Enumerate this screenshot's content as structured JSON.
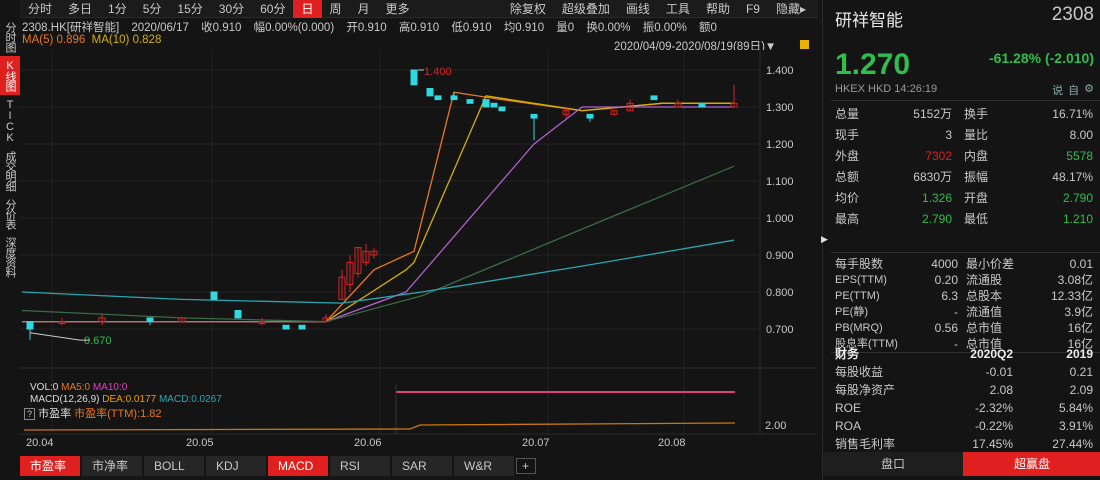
{
  "topbar": {
    "tabs": [
      "分时",
      "多日",
      "1分",
      "5分",
      "15分",
      "30分",
      "60分",
      "日",
      "周",
      "月",
      "更多"
    ],
    "active": 7,
    "right": [
      "除复权",
      "超级叠加",
      "画线",
      "工具",
      "帮助",
      "F9",
      "隐藏▸"
    ]
  },
  "sidetabs": [
    "分时图",
    "K线图",
    "TICK",
    "成交明细",
    "分价表",
    "深度资料"
  ],
  "info": {
    "symbol": "2308.HK[研祥智能]",
    "date": "2020/06/17",
    "close": "收0.910",
    "change": "幅0.00%(0.000)",
    "open": "开0.910",
    "high": "高0.910",
    "low": "低0.910",
    "avg": "均0.910",
    "vol": "量0",
    "turnover": "换0.00%",
    "amp": "振0.00%",
    "amount": "额0"
  },
  "ma": {
    "ma5": "MA(5) 0.896",
    "ma10": "MA(10) 0.828"
  },
  "date_range": "2020/04/09-2020/08/19(89日)▼",
  "indicators": {
    "row1": [
      "VOL:0",
      "MA5:0",
      "MA10:0"
    ],
    "row2": [
      "MACD(12,26,9)",
      "DEA:0.0177",
      "MACD:0.0267"
    ],
    "row3": [
      "市盈率",
      "市盈率(TTM):1.82"
    ],
    "axis": "2.00"
  },
  "chart_data": {
    "type": "candlestick",
    "ylim": [
      0.65,
      1.45
    ],
    "yticks": [
      "1.400",
      "1.300",
      "1.200",
      "1.100",
      "1.000",
      "0.900",
      "0.800",
      "0.700"
    ],
    "xticks": [
      {
        "label": "20.04",
        "i": 0
      },
      {
        "label": "20.05",
        "i": 20
      },
      {
        "label": "20.06",
        "i": 41
      },
      {
        "label": "20.07",
        "i": 62
      },
      {
        "label": "20.08",
        "i": 79
      }
    ],
    "max_label": "1.400",
    "min_label": "0.670",
    "candles": [
      [
        1,
        0.72,
        0.7,
        0.72,
        0.67
      ],
      [
        5,
        0.72,
        0.72,
        0.73,
        0.71
      ],
      [
        10,
        0.72,
        0.73,
        0.74,
        0.71
      ],
      [
        16,
        0.73,
        0.72,
        0.73,
        0.71
      ],
      [
        20,
        0.72,
        0.73,
        0.73,
        0.72
      ],
      [
        24,
        0.8,
        0.78,
        0.8,
        0.78
      ],
      [
        27,
        0.75,
        0.73,
        0.75,
        0.73
      ],
      [
        30,
        0.72,
        0.72,
        0.73,
        0.71
      ],
      [
        33,
        0.71,
        0.7,
        0.71,
        0.7
      ],
      [
        35,
        0.71,
        0.7,
        0.71,
        0.7
      ],
      [
        38,
        0.72,
        0.73,
        0.74,
        0.72
      ],
      [
        40,
        0.78,
        0.84,
        0.86,
        0.78
      ],
      [
        41,
        0.82,
        0.88,
        0.9,
        0.8
      ],
      [
        42,
        0.85,
        0.92,
        0.92,
        0.84
      ],
      [
        43,
        0.88,
        0.91,
        0.93,
        0.87
      ],
      [
        44,
        0.9,
        0.91,
        0.92,
        0.89
      ],
      [
        49,
        1.4,
        1.36,
        1.4,
        1.36
      ],
      [
        51,
        1.35,
        1.33,
        1.35,
        1.33
      ],
      [
        52,
        1.33,
        1.32,
        1.33,
        1.32
      ],
      [
        54,
        1.33,
        1.32,
        1.34,
        1.32
      ],
      [
        56,
        1.32,
        1.31,
        1.32,
        1.31
      ],
      [
        58,
        1.32,
        1.3,
        1.32,
        1.3
      ],
      [
        59,
        1.31,
        1.3,
        1.31,
        1.3
      ],
      [
        60,
        1.3,
        1.29,
        1.3,
        1.29
      ],
      [
        64,
        1.28,
        1.27,
        1.28,
        1.21
      ],
      [
        68,
        1.28,
        1.29,
        1.3,
        1.27
      ],
      [
        71,
        1.28,
        1.27,
        1.28,
        1.26
      ],
      [
        74,
        1.28,
        1.29,
        1.29,
        1.28
      ],
      [
        76,
        1.29,
        1.31,
        1.32,
        1.29
      ],
      [
        79,
        1.33,
        1.32,
        1.33,
        1.32
      ],
      [
        82,
        1.3,
        1.31,
        1.32,
        1.3
      ],
      [
        85,
        1.31,
        1.3,
        1.31,
        1.3
      ],
      [
        89,
        1.3,
        1.31,
        1.36,
        1.3
      ]
    ],
    "series": [
      {
        "name": "MA5",
        "color": "#e8781e",
        "points": [
          [
            0,
            0.72
          ],
          [
            38,
            0.72
          ],
          [
            44,
            0.86
          ],
          [
            48,
            0.9
          ],
          [
            49,
            0.91
          ],
          [
            54,
            1.34
          ],
          [
            60,
            1.32
          ],
          [
            70,
            1.29
          ],
          [
            80,
            1.31
          ],
          [
            89,
            1.31
          ]
        ]
      },
      {
        "name": "MA10",
        "color": "#d4b000",
        "points": [
          [
            0,
            0.72
          ],
          [
            38,
            0.72
          ],
          [
            48,
            0.86
          ],
          [
            49,
            0.88
          ],
          [
            58,
            1.33
          ],
          [
            70,
            1.29
          ],
          [
            80,
            1.31
          ],
          [
            89,
            1.31
          ]
        ]
      },
      {
        "name": "MA20",
        "color": "#b060d0",
        "points": [
          [
            0,
            0.72
          ],
          [
            38,
            0.72
          ],
          [
            48,
            0.8
          ],
          [
            64,
            1.2
          ],
          [
            70,
            1.3
          ],
          [
            76,
            1.3
          ],
          [
            89,
            1.3
          ]
        ]
      },
      {
        "name": "MA60",
        "color": "#3a6a48",
        "points": [
          [
            0,
            0.75
          ],
          [
            20,
            0.73
          ],
          [
            38,
            0.72
          ],
          [
            50,
            0.79
          ],
          [
            70,
            0.97
          ],
          [
            89,
            1.14
          ]
        ]
      },
      {
        "name": "MA120",
        "color": "#2aa6b0",
        "points": [
          [
            0,
            0.8
          ],
          [
            20,
            0.78
          ],
          [
            40,
            0.77
          ],
          [
            50,
            0.8
          ],
          [
            70,
            0.87
          ],
          [
            89,
            0.94
          ]
        ]
      }
    ]
  },
  "panel": {
    "name": "研祥智能",
    "code": "2308",
    "price": "1.270",
    "change": "-61.28% (-2.010)",
    "market": "HKEX  HKD  14:26:19",
    "icons": [
      "说",
      "自",
      "⚙"
    ],
    "quote": [
      [
        "总量",
        "5152万",
        "换手",
        "16.71%",
        "#c8c8c8",
        "#c8c8c8"
      ],
      [
        "现手",
        "3",
        "量比",
        "8.00",
        "#c8c8c8",
        "#c8c8c8"
      ],
      [
        "外盘",
        "7302",
        "内盘",
        "5578",
        "#e0201f",
        "#2ebd4e"
      ],
      [
        "总额",
        "6830万",
        "振幅",
        "48.17%",
        "#c8c8c8",
        "#c8c8c8"
      ],
      [
        "均价",
        "1.326",
        "开盘",
        "2.790",
        "#2ebd4e",
        "#2ebd4e"
      ],
      [
        "最高",
        "2.790",
        "最低",
        "1.210",
        "#2ebd4e",
        "#2ebd4e"
      ]
    ],
    "fund": [
      [
        "每手股数",
        "4000",
        "最小价差",
        "0.01"
      ],
      [
        "EPS(TTM)",
        "0.20",
        "流通股",
        "3.08亿"
      ],
      [
        "PE(TTM)",
        "6.3",
        "总股本",
        "12.33亿"
      ],
      [
        "PE(静)",
        "-",
        "流通值",
        "3.9亿"
      ],
      [
        "PB(MRQ)",
        "0.56",
        "总市值",
        "16亿"
      ],
      [
        "股息率(TTM)",
        "-",
        "总市值",
        "16亿"
      ]
    ],
    "fin_header": [
      "财务",
      "2020Q2",
      "2019"
    ],
    "fin": [
      [
        "每股收益",
        "-0.01",
        "0.21"
      ],
      [
        "每股净资产",
        "2.08",
        "2.09"
      ],
      [
        "ROE",
        "-2.32%",
        "5.84%"
      ],
      [
        "ROA",
        "-0.22%",
        "3.91%"
      ],
      [
        "销售毛利率",
        "17.45%",
        "27.44%"
      ]
    ],
    "bottom": [
      "盘口",
      "超赢盘"
    ]
  },
  "bottom_tabs": [
    "市盈率",
    "市净率",
    "BOLL",
    "KDJ",
    "MACD",
    "RSI",
    "SAR",
    "W&R",
    "+"
  ],
  "colors": {
    "up": "#e0201f",
    "down": "#2ebd4e",
    "candle_down": "#30d8e0",
    "accent": "#e0201f"
  }
}
